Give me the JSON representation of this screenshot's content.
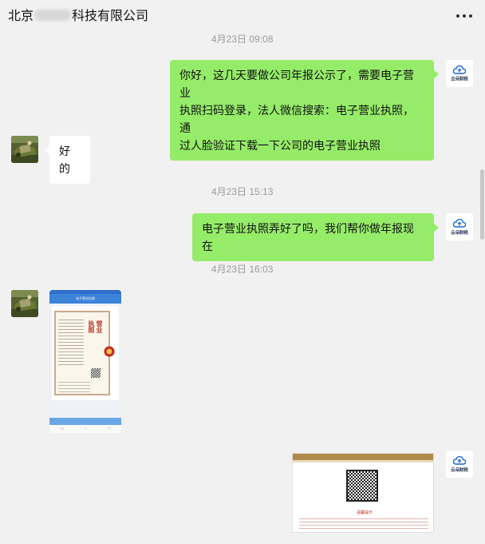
{
  "chat": {
    "title_prefix": "北京",
    "title_suffix": "科技有限公司"
  },
  "messages": [
    {
      "type": "timestamp",
      "text": "4月23日 09:08"
    },
    {
      "type": "text",
      "side": "sent",
      "lines": [
        "你好，这几天要做公司年报公示了，需要电子营业",
        "执照扫码登录，法人微信搜索：电子营业执照，通",
        "过人脸验证下载一下公司的电子营业执照"
      ]
    },
    {
      "type": "text",
      "side": "received",
      "text": "好的"
    },
    {
      "type": "timestamp",
      "text": "4月23日 15:13"
    },
    {
      "type": "text",
      "side": "sent",
      "text": "电子营业执照弄好了吗，我们帮你做年报现在"
    },
    {
      "type": "timestamp",
      "text": "4月23日 16:03"
    },
    {
      "type": "image",
      "side": "received",
      "title": "电子营业执照",
      "license_title": "营业执照"
    },
    {
      "type": "image",
      "side": "sent",
      "caption": "温馨提示"
    }
  ],
  "avatars": {
    "me_brand": "云朵财税"
  },
  "colors": {
    "sent_bubble": "#95ec69",
    "received_bubble": "#ffffff",
    "background": "#f1f1f1",
    "phone_header": "#3b82d8"
  },
  "icons": [
    "more-icon",
    "cloud-logo-icon",
    "national-emblem-icon",
    "qr-code-icon"
  ]
}
